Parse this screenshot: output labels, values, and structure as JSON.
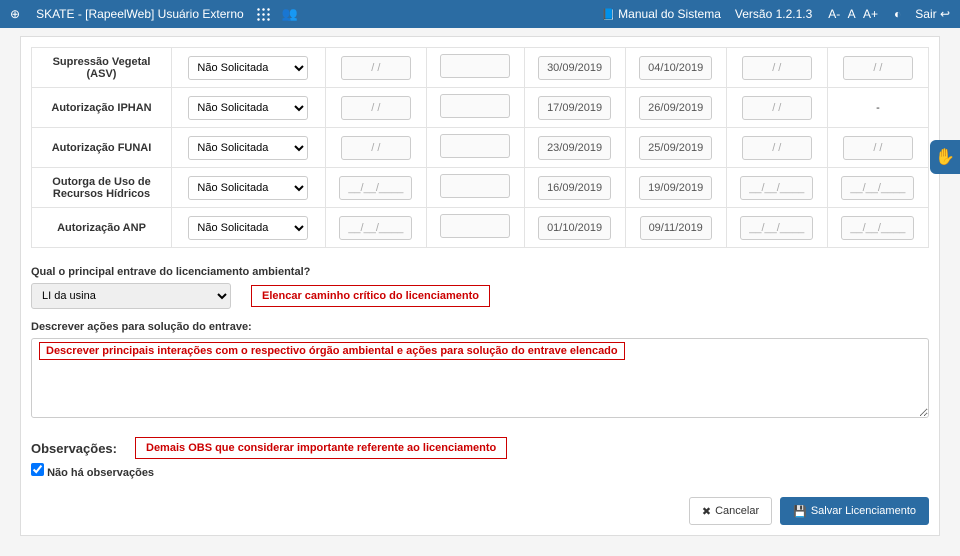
{
  "topbar": {
    "title": "SKATE - [RapeelWeb] Usuário Externo",
    "manual": "Manual do Sistema",
    "version": "Versão 1.2.1.3",
    "fontDown": "A-",
    "fontReset": "A",
    "fontUp": "A+",
    "sair": "Sair"
  },
  "rows": [
    {
      "label": "Supressão Vegetal (ASV)",
      "status": "Não Solicitada",
      "d1": "/ /",
      "d2": "",
      "d3": "30/09/2019",
      "d4": "04/10/2019",
      "d5": "/ /",
      "d6": "/ /"
    },
    {
      "label": "Autorização IPHAN",
      "status": "Não Solicitada",
      "d1": "/ /",
      "d2": "",
      "d3": "17/09/2019",
      "d4": "26/09/2019",
      "d5": "/ /",
      "d6": "-"
    },
    {
      "label": "Autorização FUNAI",
      "status": "Não Solicitada",
      "d1": "/ /",
      "d2": "",
      "d3": "23/09/2019",
      "d4": "25/09/2019",
      "d5": "/ /",
      "d6": "/ /"
    },
    {
      "label": "Outorga de Uso de Recursos Hídricos",
      "status": "Não Solicitada",
      "d1": "__/__/____",
      "d2": "",
      "d3": "16/09/2019",
      "d4": "19/09/2019",
      "d5": "__/__/____",
      "d6": "__/__/____"
    },
    {
      "label": "Autorização ANP",
      "status": "Não Solicitada",
      "d1": "__/__/____",
      "d2": "",
      "d3": "01/10/2019",
      "d4": "09/11/2019",
      "d5": "__/__/____",
      "d6": "__/__/____"
    }
  ],
  "principal": {
    "question": "Qual o principal entrave do licenciamento ambiental?",
    "selected": "LI da usina",
    "callout": "Elencar caminho crítico do licenciamento"
  },
  "acoes": {
    "label": "Descrever ações para solução do entrave:",
    "callout": "Descrever principais interações com o respectivo órgão ambiental e ações para solução do entrave elencado"
  },
  "obs": {
    "label": "Observações:",
    "callout": "Demais OBS que considerar importante referente ao licenciamento",
    "checkboxLabel": "Não há observações"
  },
  "buttons": {
    "cancel": "Cancelar",
    "save": "Salvar Licenciamento"
  },
  "sideTab": "✋"
}
